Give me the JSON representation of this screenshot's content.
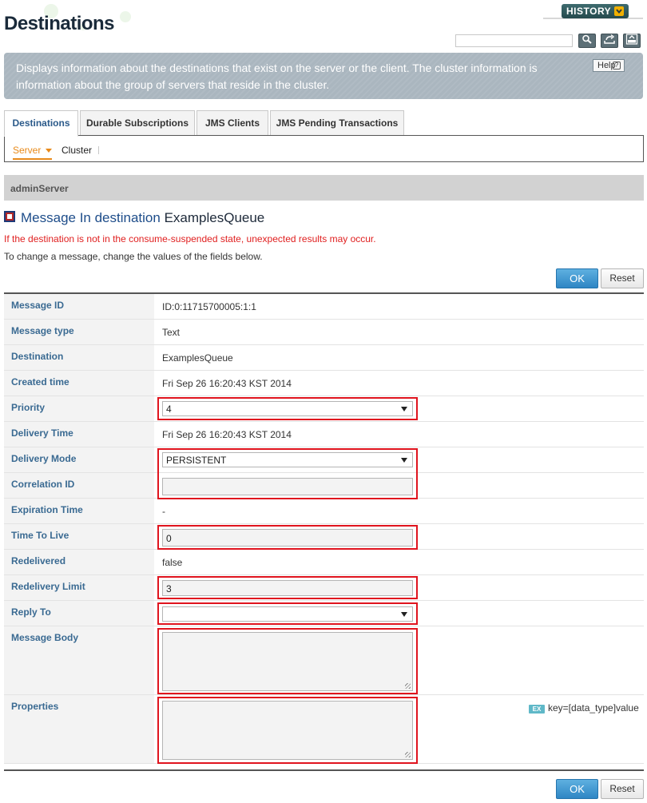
{
  "header": {
    "title": "Destinations",
    "history_label": "HISTORY",
    "search_placeholder": ""
  },
  "banner": {
    "text": "Displays information about the destinations that exist on the server or the client. The cluster information is information about the group of servers that reside in the cluster.",
    "help_label": "Help",
    "help_glyph": "?"
  },
  "tabs": [
    {
      "label": "Destinations",
      "active": true
    },
    {
      "label": "Durable Subscriptions",
      "active": false
    },
    {
      "label": "JMS Clients",
      "active": false
    },
    {
      "label": "JMS Pending Transactions",
      "active": false
    }
  ],
  "subtabs": {
    "server": "Server",
    "cluster": "Cluster"
  },
  "server_bar": {
    "name": "adminServer"
  },
  "section": {
    "title": "Message In destination",
    "destination_name": "ExamplesQueue",
    "warning": "If the destination is not in the consume-suspended state, unexpected results may occur.",
    "instruction": "To change a message, change the values of the fields below."
  },
  "buttons": {
    "ok_label": "OK",
    "reset_label": "Reset"
  },
  "form": {
    "message_id": {
      "label": "Message ID",
      "value": "ID:0:11715700005:1:1"
    },
    "message_type": {
      "label": "Message type",
      "value": "Text"
    },
    "destination": {
      "label": "Destination",
      "value": "ExamplesQueue"
    },
    "created_time": {
      "label": "Created time",
      "value": "Fri Sep 26 16:20:43 KST 2014"
    },
    "priority": {
      "label": "Priority",
      "value": "4"
    },
    "delivery_time": {
      "label": "Delivery Time",
      "value": "Fri Sep 26 16:20:43 KST 2014"
    },
    "delivery_mode": {
      "label": "Delivery Mode",
      "value": "PERSISTENT"
    },
    "correlation_id": {
      "label": "Correlation ID",
      "value": ""
    },
    "expiration_time": {
      "label": "Expiration Time",
      "value": "-"
    },
    "time_to_live": {
      "label": "Time To Live",
      "value": "0"
    },
    "redelivered": {
      "label": "Redelivered",
      "value": "false"
    },
    "redelivery_limit": {
      "label": "Redelivery Limit",
      "value": "3"
    },
    "reply_to": {
      "label": "Reply To",
      "value": ""
    },
    "message_body": {
      "label": "Message Body",
      "value": ""
    },
    "properties": {
      "label": "Properties",
      "value": "",
      "example_badge": "EX",
      "example_hint": "key=[data_type]value"
    }
  },
  "colors": {
    "accent_blue": "#2f86c4",
    "highlight_red": "#e0141e",
    "warning_red": "#e02020",
    "label_blue": "#3a6a92",
    "active_orange": "#e88a1a"
  },
  "icons": [
    "search-icon",
    "refresh-icon",
    "xml-icon",
    "help-icon",
    "chevron-down-icon",
    "section-icon"
  ]
}
